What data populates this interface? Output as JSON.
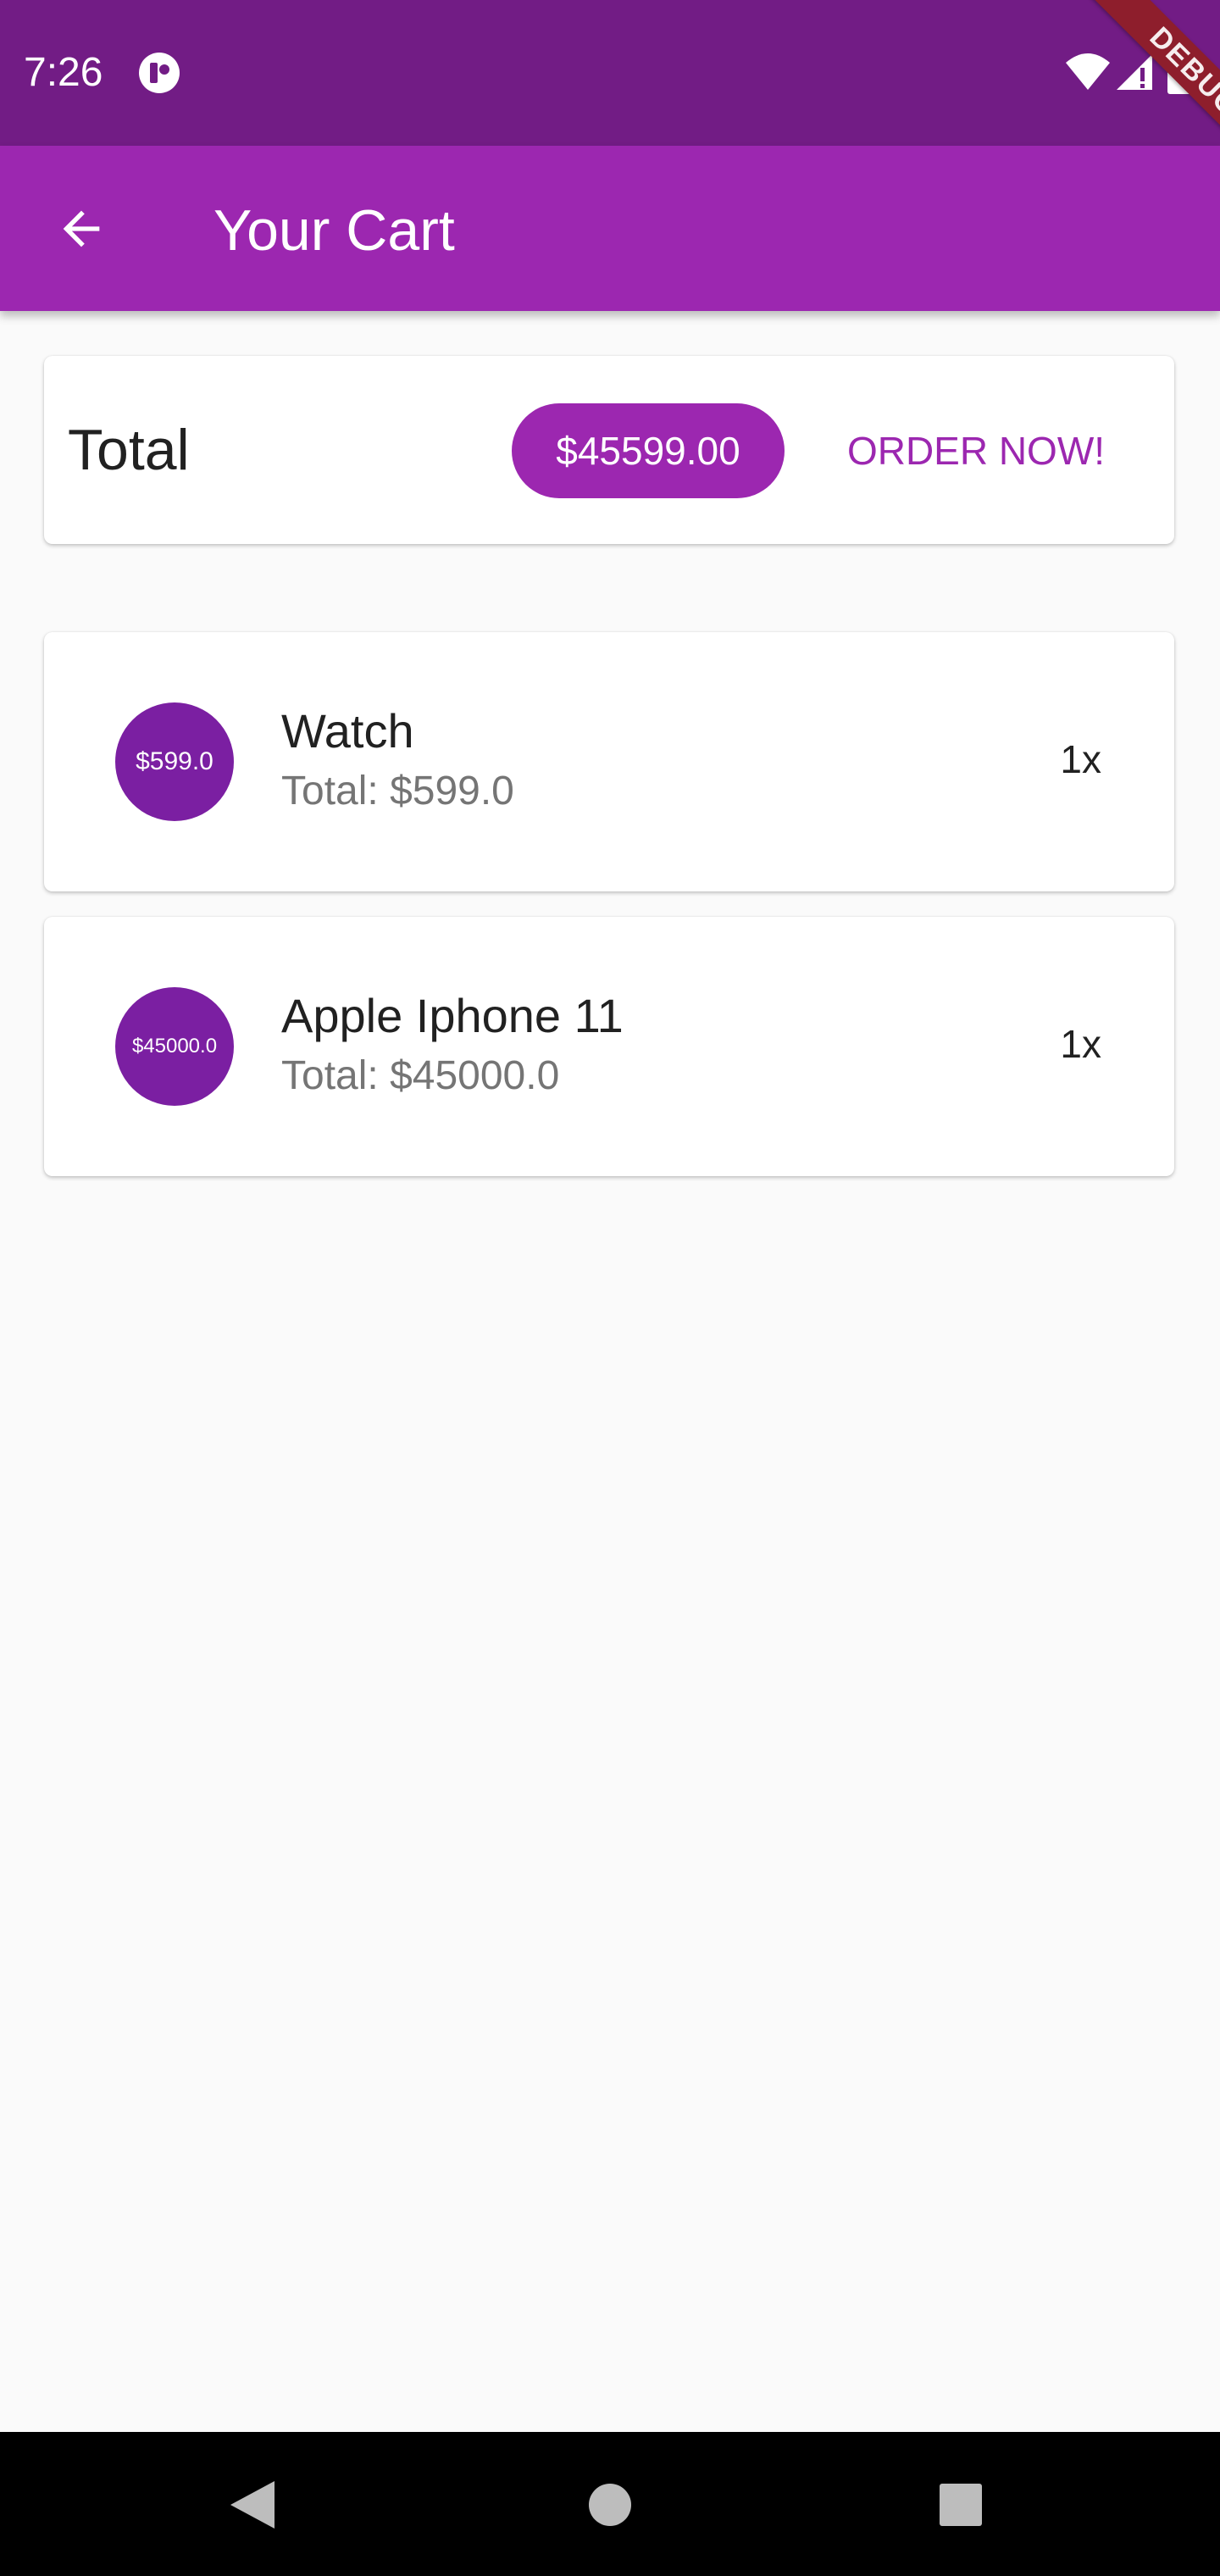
{
  "status_bar": {
    "time": "7:26",
    "debug_label": "DEBUG",
    "icons": [
      "app-notification-icon",
      "wifi-icon",
      "signal-icon",
      "battery-icon"
    ]
  },
  "app_bar": {
    "title": "Your Cart",
    "back_icon": "arrow-back-icon"
  },
  "summary": {
    "label": "Total",
    "amount": "$45599.00",
    "order_button": "ORDER NOW!"
  },
  "cart_items": [
    {
      "price_badge": "$599.0",
      "title": "Watch",
      "subtitle": "Total: $599.0",
      "quantity": "1x"
    },
    {
      "price_badge": "$45000.0",
      "title": "Apple Iphone 11",
      "subtitle": "Total: $45000.0",
      "quantity": "1x"
    }
  ],
  "nav_bar": {
    "icons": [
      "nav-back-icon",
      "nav-home-icon",
      "nav-recents-icon"
    ]
  },
  "colors": {
    "primary": "#9c27b0",
    "primary_dark": "#721c85",
    "avatar": "#7b1fa2",
    "background": "#fafafa"
  }
}
